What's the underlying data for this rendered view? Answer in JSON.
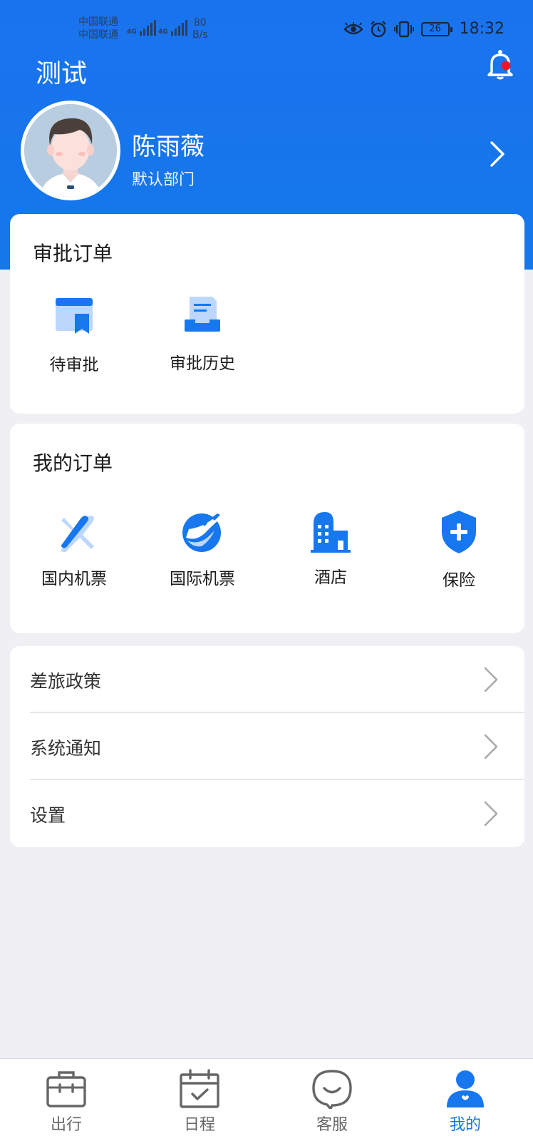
{
  "status_bar": {
    "carrier_1": "中国联通",
    "carrier_2": "中国联通",
    "network_1": "4G",
    "network_2": "4G",
    "net_speed_value": "80",
    "net_speed_unit": "B/s",
    "battery": "26",
    "time": "18:32"
  },
  "header": {
    "app_title": "测试",
    "user_name": "陈雨薇",
    "department": "默认部门",
    "notification_dot_color": "#e8182c"
  },
  "approval_card": {
    "title": "审批订单",
    "items": [
      {
        "label": "待审批",
        "icon": "pending-approval-icon"
      },
      {
        "label": "审批历史",
        "icon": "approval-history-icon"
      }
    ]
  },
  "orders_card": {
    "title": "我的订单",
    "items": [
      {
        "label": "国内机票",
        "icon": "domestic-flight-icon"
      },
      {
        "label": "国际机票",
        "icon": "international-flight-icon"
      },
      {
        "label": "酒店",
        "icon": "hotel-icon"
      },
      {
        "label": "保险",
        "icon": "insurance-shield-icon"
      }
    ]
  },
  "menu": {
    "items": [
      {
        "label": "差旅政策"
      },
      {
        "label": "系统通知"
      },
      {
        "label": "设置"
      }
    ]
  },
  "tabbar": {
    "items": [
      {
        "label": "出行",
        "icon": "briefcase-icon",
        "active": false
      },
      {
        "label": "日程",
        "icon": "calendar-icon",
        "active": false
      },
      {
        "label": "客服",
        "icon": "chat-smile-icon",
        "active": false
      },
      {
        "label": "我的",
        "icon": "user-icon",
        "active": true
      }
    ]
  },
  "colors": {
    "brand_blue": "#1677ee",
    "header_blue": "#1a73ee",
    "page_bg": "#efeff4"
  }
}
